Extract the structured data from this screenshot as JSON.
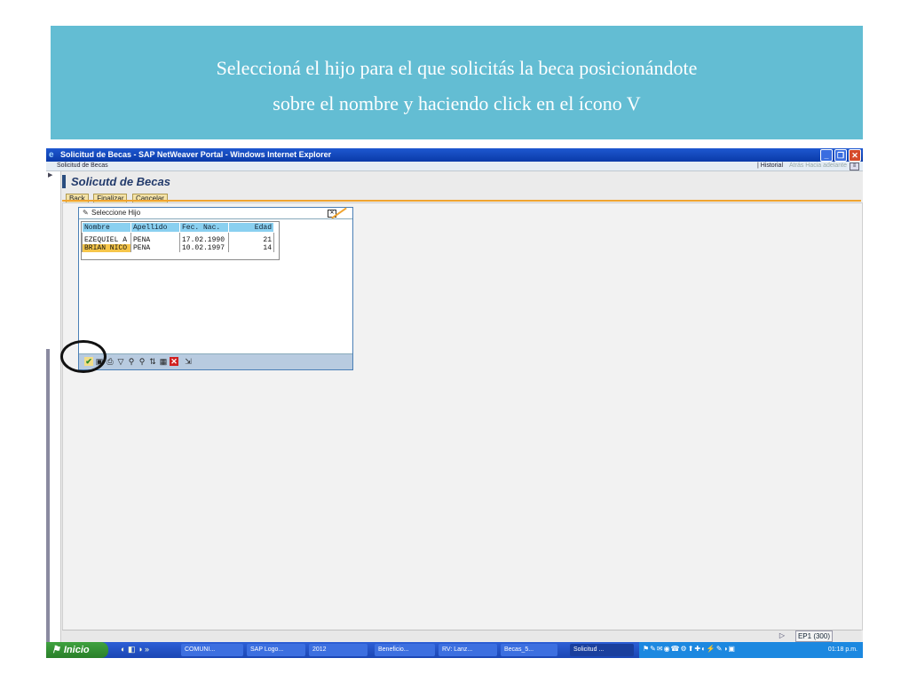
{
  "slide": {
    "line1": "Seleccioná el hijo para el que solicitás la beca posicionándote",
    "line2": "sobre el nombre y haciendo click en el ícono V"
  },
  "window": {
    "title": "Solicitud de Becas - SAP NetWeaver Portal - Windows Internet Explorer"
  },
  "portal": {
    "breadcrumb": "Solicitud de Becas",
    "history": "| Historial",
    "back": "Atrás",
    "forward": "Hacia adelante"
  },
  "page": {
    "title": "Solicutd de Becas",
    "buttons": [
      "Back",
      "Finalizar",
      "Cancelar"
    ]
  },
  "dialog": {
    "title": "Seleccione Hijo",
    "columns": [
      "Nombre",
      "Apellido",
      "Fec. Nac.",
      "Edad"
    ],
    "rows": [
      [
        "EZEQUIEL A",
        "PENA",
        "17.02.1990",
        "21"
      ],
      [
        "BRIAN NICO",
        "PENA",
        "10.02.1997",
        "14"
      ]
    ],
    "selected_row": 1
  },
  "status": {
    "system": "EP1 (300)"
  },
  "taskbar": {
    "start": "Inicio",
    "quick_more": "»",
    "tasks": [
      "COMUNI...",
      "SAP Logo...",
      "2012",
      "Beneficio...",
      "RV: Lanz...",
      "Becas_5...",
      "Solicitud ..."
    ],
    "clock": "01:18 p.m."
  },
  "colors": {
    "banner": "#63bdd3",
    "header_cells": "#8ad0f0",
    "selection": "#f6c64a",
    "accent_line": "#f0a430"
  }
}
